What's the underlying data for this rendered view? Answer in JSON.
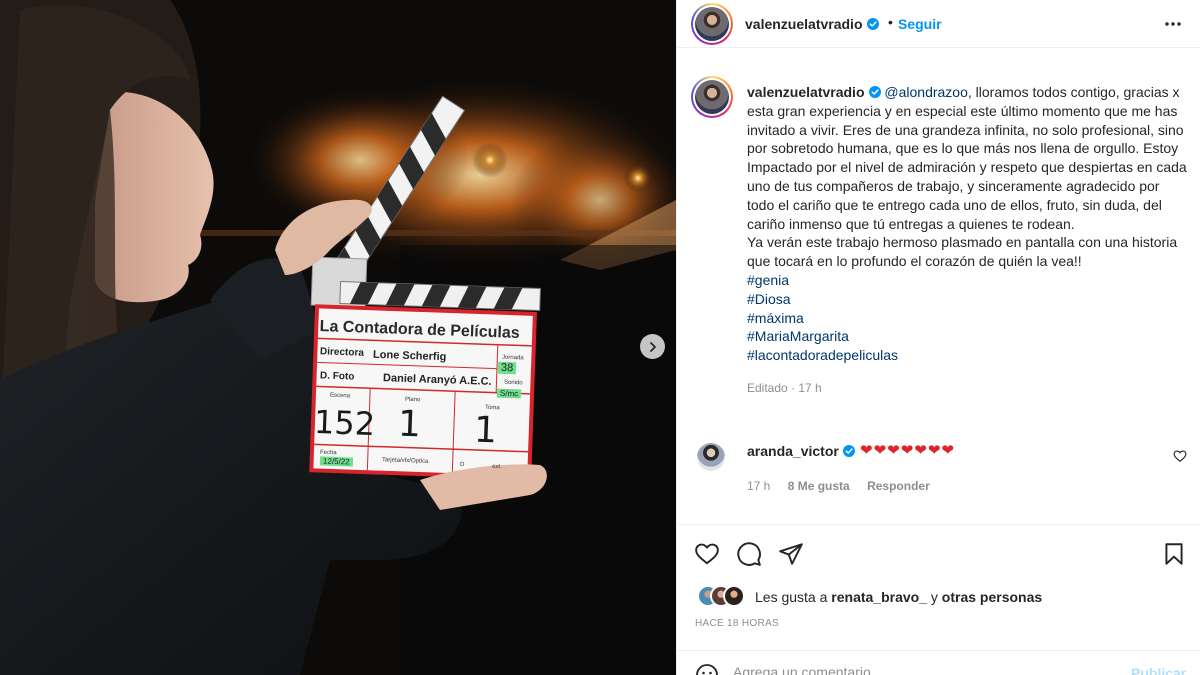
{
  "post": {
    "username": "valenzuelatvradio",
    "follow_label": "Seguir",
    "dot": "•"
  },
  "clapperboard": {
    "title": "La Contadora de Películas",
    "director_label": "Directora",
    "director": "Lone Scherfig",
    "jornada_label": "Jornada",
    "jornada": "38",
    "dfoto_label": "D. Foto",
    "dfoto": "Daniel Aranyó A.E.C.",
    "sonido_label": "Sonido",
    "sonido": "S/mc",
    "escena_label": "Escena",
    "escena": "152",
    "plano_label": "Plano",
    "plano": "1",
    "toma_label": "Toma",
    "toma": "1",
    "fecha_label": "Fecha",
    "fecha": "12/5/22",
    "tarjeta_label": "Tarjeta/vfx/Optica",
    "d_label": "D",
    "ext_label": "ext."
  },
  "caption": {
    "username": "valenzuelatvradio",
    "mention": "@alondrazoo",
    "text1": ", lloramos todos contigo, gracias x esta gran experiencia y en especial este último momento que me has invitado a vivir. Eres de una grandeza infinita, no solo profesional, sino por sobretodo humana, que es lo que más nos llena de orgullo. Estoy Impactado por el nivel de admiración y respeto que despiertas en cada uno de tus compañeros de trabajo, y sinceramente agradecido por todo el cariño que te entrego cada uno de ellos, fruto, sin duda, del cariño inmenso que tú entregas a quienes te rodean.",
    "text2": "Ya verán este trabajo hermoso plasmado en pantalla con una historia que tocará en lo profundo el corazón de quién la vea!!",
    "hashtags": [
      "#genia",
      "#Diosa",
      "#máxima",
      "#MariaMargarita",
      "#lacontadoradepeliculas"
    ],
    "meta": "Editado · 17 h"
  },
  "comment": {
    "username": "aranda_victor",
    "text": "❤❤❤❤❤❤❤",
    "time": "17 h",
    "likes": "8 Me gusta",
    "reply": "Responder"
  },
  "likes": {
    "prefix": "Les gusta a",
    "user": "renata_bravo_",
    "middle": "y",
    "others": "otras personas"
  },
  "time_ago": "HACE 18 HORAS",
  "add_comment": {
    "placeholder": "Agrega un comentario...",
    "post_label": "Publicar"
  },
  "colors": {
    "link_blue": "#0095f6",
    "mention": "#00376b",
    "heart_red": "#e0242a",
    "muted": "#8e8e8e"
  }
}
